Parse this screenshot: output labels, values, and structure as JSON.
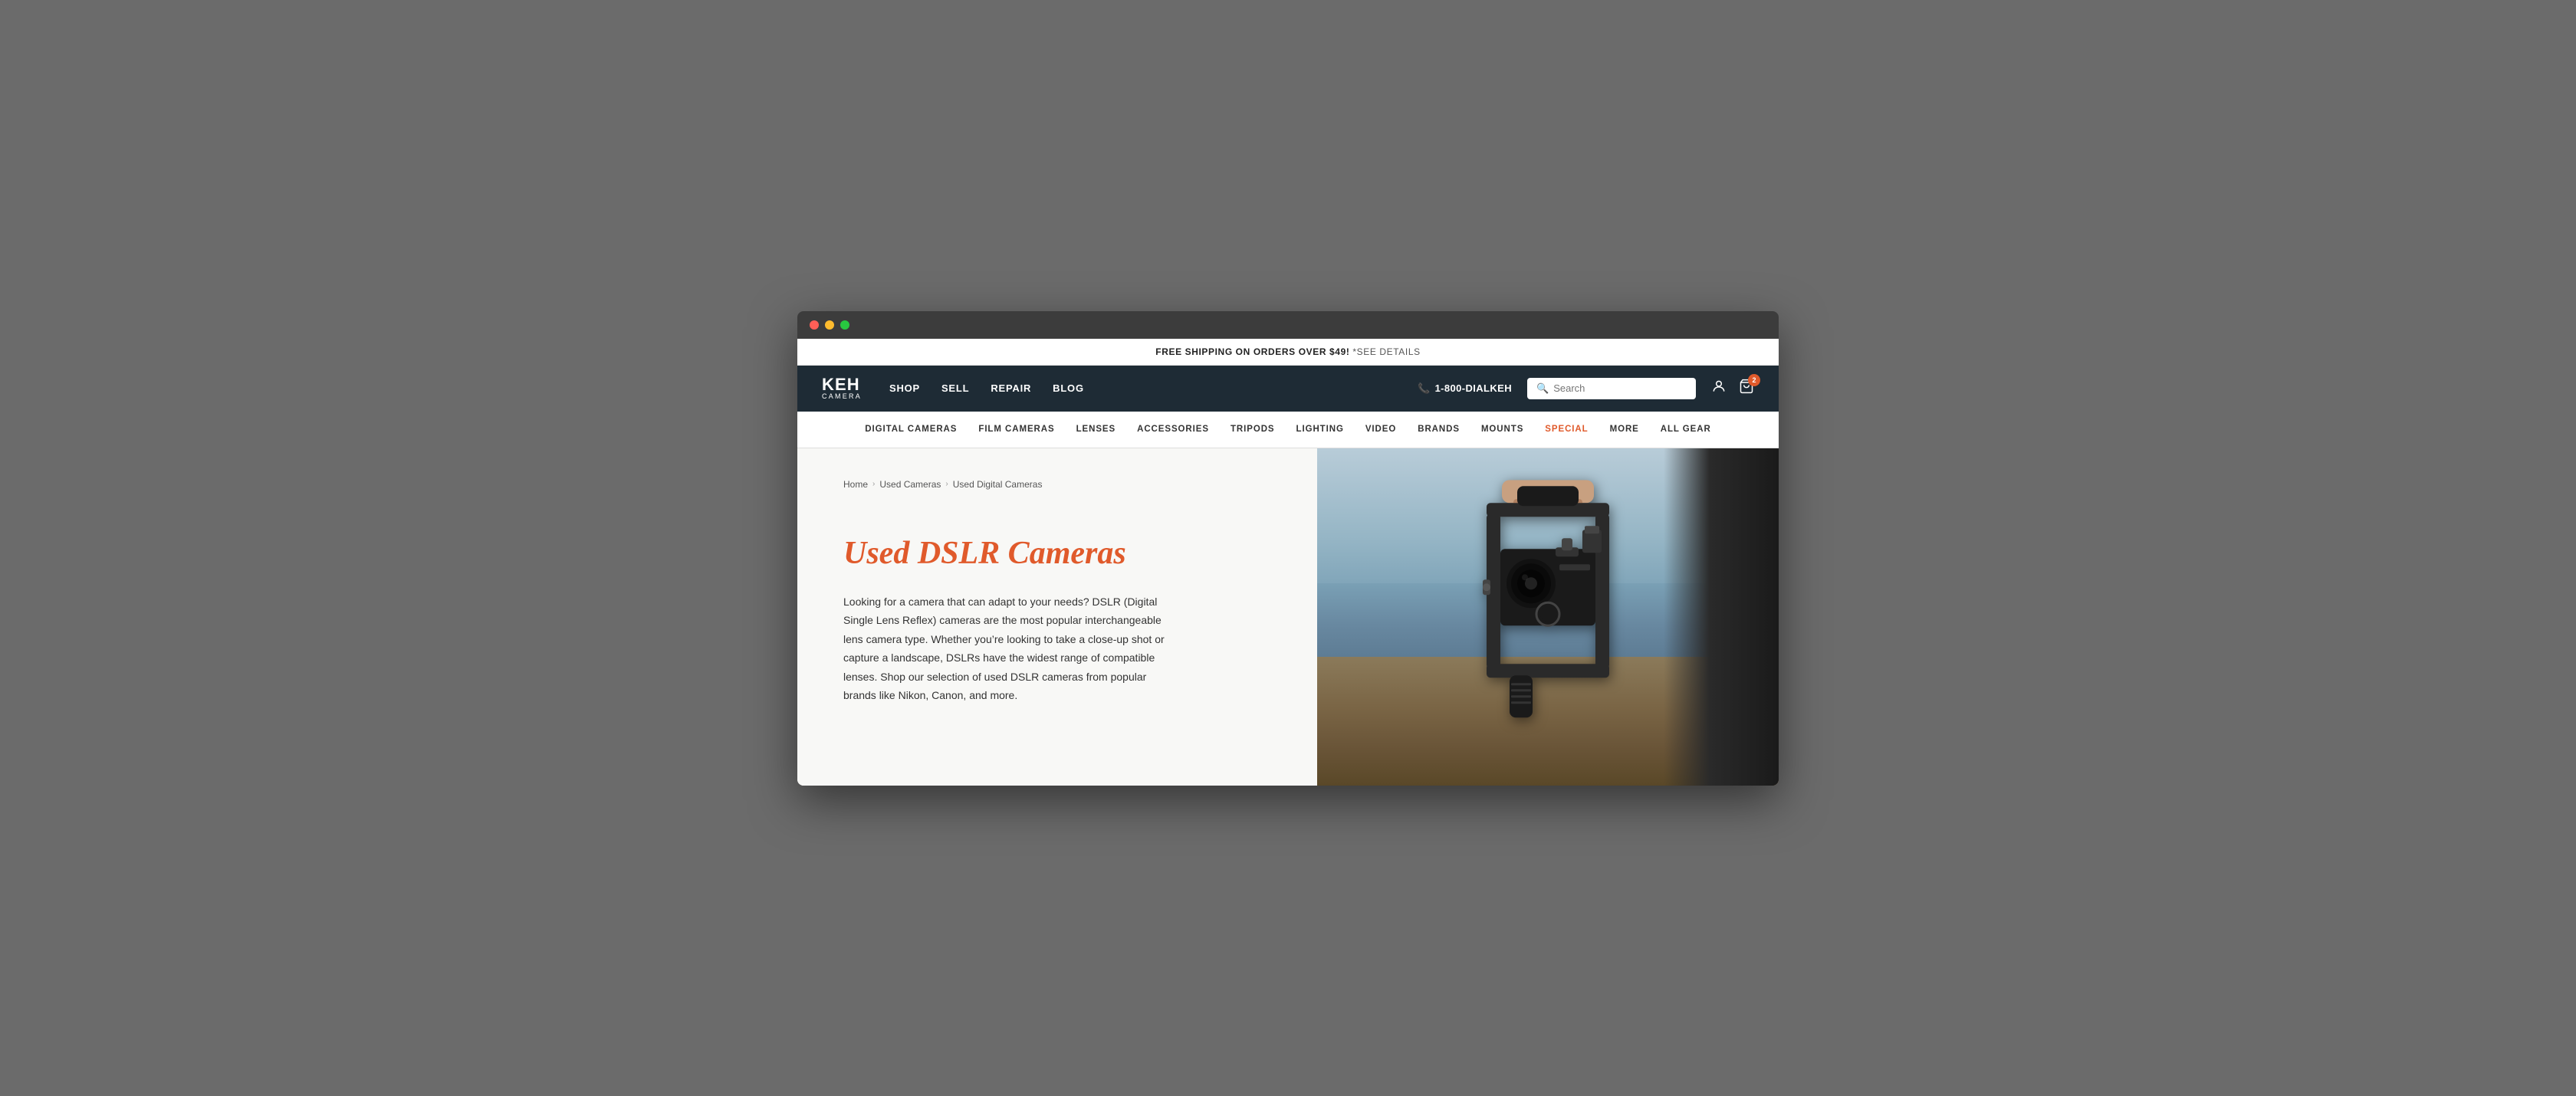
{
  "browser": {
    "dots": [
      "red",
      "yellow",
      "green"
    ]
  },
  "promo": {
    "text": "FREE SHIPPING ON ORDERS OVER $49!",
    "details": " *SEE DETAILS"
  },
  "logo": {
    "keh": "KEH",
    "camera": "CAMERA"
  },
  "nav": {
    "links": [
      {
        "label": "SHOP",
        "href": "#"
      },
      {
        "label": "SELL",
        "href": "#"
      },
      {
        "label": "REPAIR",
        "href": "#"
      },
      {
        "label": "BLOG",
        "href": "#"
      }
    ],
    "phone": "1-800-DIALKEH",
    "search_placeholder": "Search",
    "cart_count": "2"
  },
  "categories": [
    {
      "label": "DIGITAL CAMERAS",
      "special": false
    },
    {
      "label": "FILM CAMERAS",
      "special": false
    },
    {
      "label": "LENSES",
      "special": false
    },
    {
      "label": "ACCESSORIES",
      "special": false
    },
    {
      "label": "TRIPODS",
      "special": false
    },
    {
      "label": "LIGHTING",
      "special": false
    },
    {
      "label": "VIDEO",
      "special": false
    },
    {
      "label": "BRANDS",
      "special": false
    },
    {
      "label": "MOUNTS",
      "special": false
    },
    {
      "label": "SPECIAL",
      "special": true
    },
    {
      "label": "MORE",
      "special": false
    },
    {
      "label": "ALL GEAR",
      "special": false
    }
  ],
  "breadcrumb": {
    "home": "Home",
    "used_cameras": "Used Cameras",
    "current": "Used Digital Cameras"
  },
  "hero": {
    "title": "Used DSLR Cameras",
    "description": "Looking for a camera that can adapt to your needs? DSLR (Digital Single Lens Reflex) cameras are the most popular interchangeable lens camera type. Whether you’re looking to take a close-up shot or capture a landscape, DSLRs have the widest range of compatible lenses. Shop our selection of used DSLR cameras from popular brands like Nikon, Canon, and more."
  }
}
